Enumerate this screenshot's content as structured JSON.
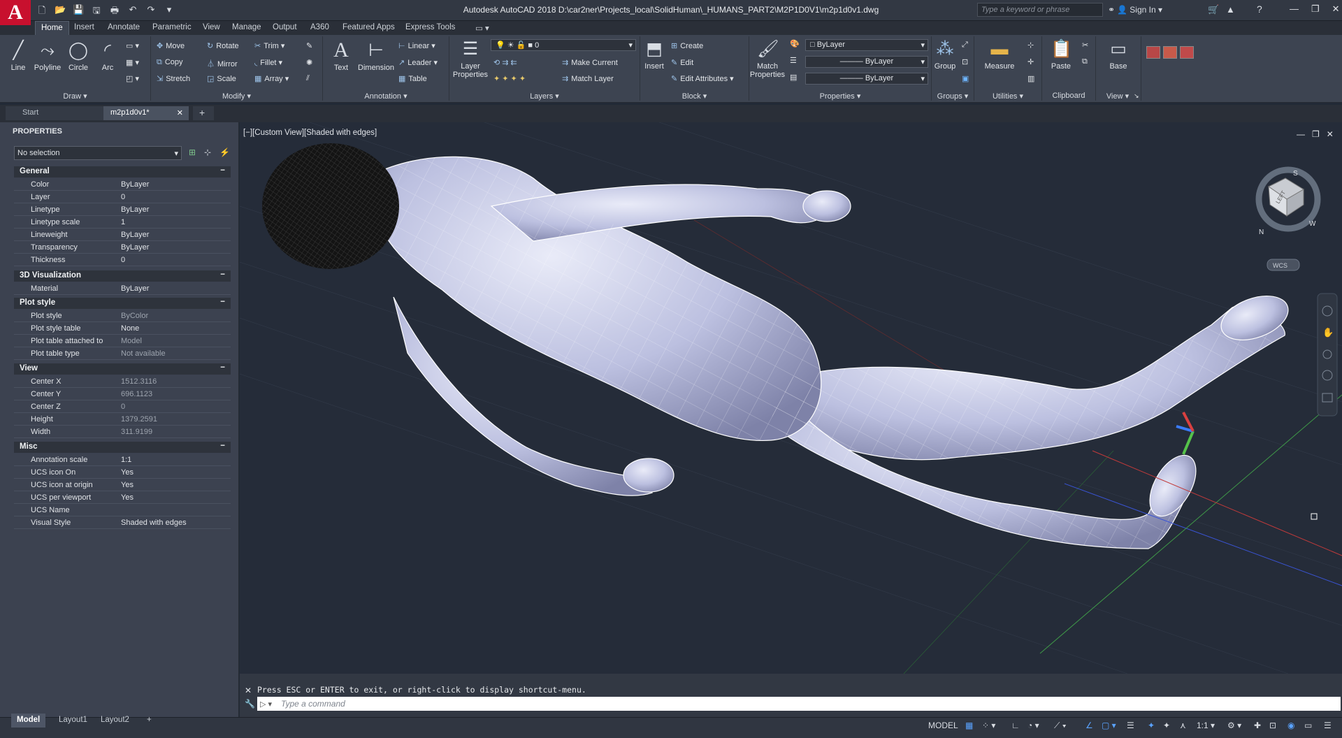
{
  "app": {
    "title": "Autodesk AutoCAD 2018   D:\\car2ner\\Projects_local\\SolidHuman\\_HUMANS_PART2\\M2P1D0V1\\m2p1d0v1.dwg",
    "search_placeholder": "Type a keyword or phrase",
    "sign_in": "Sign In"
  },
  "ribbon_tabs": [
    "Home",
    "Insert",
    "Annotate",
    "Parametric",
    "View",
    "Manage",
    "Output",
    "A360",
    "Featured Apps",
    "Express Tools"
  ],
  "draw": {
    "panel": "Draw",
    "line": "Line",
    "polyline": "Polyline",
    "circle": "Circle",
    "arc": "Arc"
  },
  "modify": {
    "panel": "Modify",
    "move": "Move",
    "rotate": "Rotate",
    "trim": "Trim",
    "copy": "Copy",
    "mirror": "Mirror",
    "fillet": "Fillet",
    "stretch": "Stretch",
    "scale": "Scale",
    "array": "Array"
  },
  "annotation": {
    "panel": "Annotation",
    "text": "Text",
    "dimension": "Dimension",
    "linear": "Linear",
    "leader": "Leader",
    "table": "Table"
  },
  "layers": {
    "panel": "Layers",
    "layer_properties": "Layer Properties",
    "current_layer": "0",
    "make_current": "Make Current",
    "match_layer": "Match Layer"
  },
  "block": {
    "panel": "Block",
    "insert": "Insert",
    "create": "Create",
    "edit": "Edit",
    "edit_attributes": "Edit Attributes"
  },
  "properties_panel": {
    "panel": "Properties",
    "match_properties": "Match Properties",
    "color": "ByLayer",
    "linetype": "ByLayer",
    "lineweight": "ByLayer"
  },
  "groups": {
    "panel": "Groups",
    "group": "Group"
  },
  "utilities": {
    "panel": "Utilities",
    "measure": "Measure"
  },
  "clipboard": {
    "panel": "Clipboard",
    "paste": "Paste"
  },
  "view_panel": {
    "panel": "View",
    "base": "Base"
  },
  "doc_tabs": {
    "start": "Start",
    "file": "m2p1d0v1*"
  },
  "palette": {
    "title": "PROPERTIES",
    "selection": "No selection",
    "general": {
      "title": "General",
      "rows": [
        {
          "k": "Color",
          "v": "ByLayer"
        },
        {
          "k": "Layer",
          "v": "0"
        },
        {
          "k": "Linetype",
          "v": "ByLayer"
        },
        {
          "k": "Linetype scale",
          "v": "1"
        },
        {
          "k": "Lineweight",
          "v": "ByLayer"
        },
        {
          "k": "Transparency",
          "v": "ByLayer"
        },
        {
          "k": "Thickness",
          "v": "0"
        }
      ]
    },
    "viz": {
      "title": "3D Visualization",
      "rows": [
        {
          "k": "Material",
          "v": "ByLayer"
        }
      ]
    },
    "plot": {
      "title": "Plot style",
      "rows": [
        {
          "k": "Plot style",
          "v": "ByColor"
        },
        {
          "k": "Plot style table",
          "v": "None"
        },
        {
          "k": "Plot table attached to",
          "v": "Model"
        },
        {
          "k": "Plot table type",
          "v": "Not available"
        }
      ]
    },
    "view": {
      "title": "View",
      "rows": [
        {
          "k": "Center X",
          "v": "1512.3116"
        },
        {
          "k": "Center Y",
          "v": "696.1123"
        },
        {
          "k": "Center Z",
          "v": "0"
        },
        {
          "k": "Height",
          "v": "1379.2591"
        },
        {
          "k": "Width",
          "v": "311.9199"
        }
      ]
    },
    "misc": {
      "title": "Misc",
      "rows": [
        {
          "k": "Annotation scale",
          "v": "1:1"
        },
        {
          "k": "UCS icon On",
          "v": "Yes"
        },
        {
          "k": "UCS icon at origin",
          "v": "Yes"
        },
        {
          "k": "UCS per viewport",
          "v": "Yes"
        },
        {
          "k": "UCS Name",
          "v": ""
        },
        {
          "k": "Visual Style",
          "v": "Shaded with edges"
        }
      ]
    }
  },
  "viewport": {
    "label": "[−][Custom View][Shaded with edges]",
    "viewcube_face": "LEFT",
    "wcs": "WCS",
    "compass": [
      "S",
      "W",
      "N"
    ]
  },
  "command": {
    "history": "Press ESC or ENTER to exit, or right-click to display shortcut-menu.",
    "placeholder": "Type a command"
  },
  "layout_tabs": [
    "Model",
    "Layout1",
    "Layout2"
  ],
  "status": {
    "space": "MODEL",
    "scale": "1:1"
  },
  "colors": {
    "ribbon": "#3d4451",
    "viewport_bg": "#252c39",
    "autocad_red": "#c8102e",
    "mesh_fill": "#c8cbe8",
    "mesh_edge": "#ffffff",
    "hair": "#151515"
  }
}
